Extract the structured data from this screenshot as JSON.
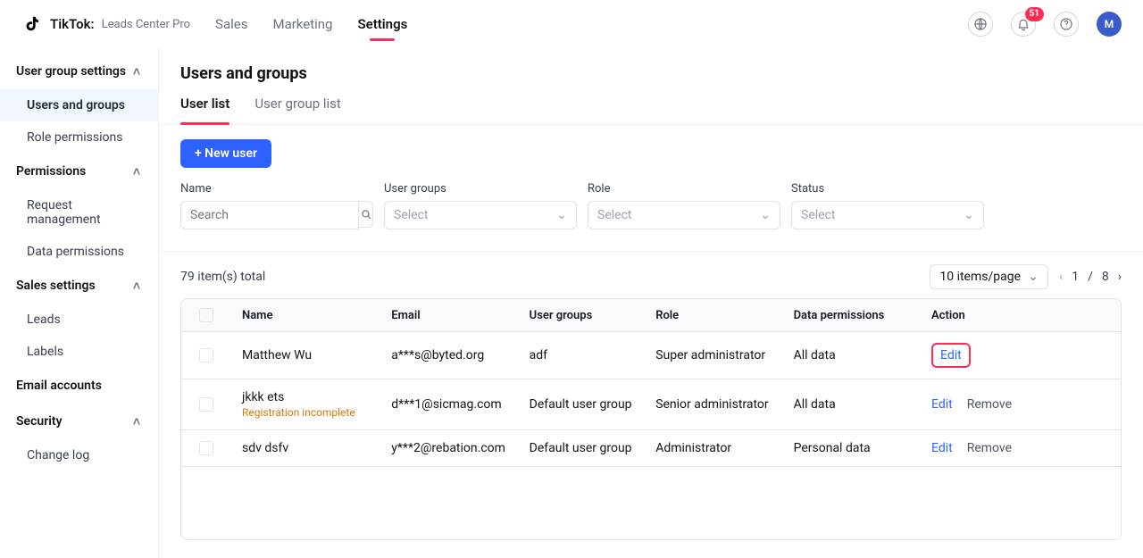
{
  "header": {
    "brand_main": "TikTok:",
    "brand_sub": "Leads Center Pro",
    "nav": [
      "Sales",
      "Marketing",
      "Settings"
    ],
    "nav_active_index": 2,
    "notification_count": "51",
    "avatar_letter": "M"
  },
  "sidebar": {
    "sections": [
      {
        "title": "User group settings",
        "expanded": true,
        "items": [
          "Users and groups",
          "Role permissions"
        ],
        "active_index": 0
      },
      {
        "title": "Permissions",
        "expanded": true,
        "items": [
          "Request management",
          "Data permissions"
        ]
      },
      {
        "title": "Sales settings",
        "expanded": true,
        "items": [
          "Leads",
          "Labels"
        ]
      },
      {
        "title": "Email accounts",
        "single": true
      },
      {
        "title": "Security",
        "expanded": true,
        "items": [
          "Change log"
        ]
      }
    ]
  },
  "page": {
    "title": "Users and groups",
    "subtabs": [
      "User list",
      "User group list"
    ],
    "subtab_active_index": 0,
    "new_user_label": "+ New user"
  },
  "filters": {
    "name": {
      "label": "Name",
      "placeholder": "Search"
    },
    "user_groups": {
      "label": "User groups",
      "placeholder": "Select"
    },
    "role": {
      "label": "Role",
      "placeholder": "Select"
    },
    "status": {
      "label": "Status",
      "placeholder": "Select"
    }
  },
  "table": {
    "total_text": "79 item(s) total",
    "page_size_label": "10 items/page",
    "current_page": "1",
    "sep": "/",
    "total_pages": "8",
    "columns": [
      "Name",
      "Email",
      "User groups",
      "Role",
      "Data permissions",
      "Action"
    ],
    "actions": {
      "edit": "Edit",
      "remove": "Remove"
    },
    "rows": [
      {
        "name": "Matthew Wu",
        "warn": "",
        "email": "a***s@byted.org",
        "groups": "adf",
        "role": "Super administrator",
        "perm": "All data",
        "removable": false,
        "highlight_edit": true
      },
      {
        "name": "jkkk ets",
        "warn": "Registration incomplete",
        "email": "d***1@sicmag.com",
        "groups": "Default user group",
        "role": "Senior administrator",
        "perm": "All data",
        "removable": true,
        "highlight_edit": false
      },
      {
        "name": "sdv dsfv",
        "warn": "",
        "email": "y***2@rebation.com",
        "groups": "Default user group",
        "role": "Administrator",
        "perm": "Personal data",
        "removable": true,
        "highlight_edit": false
      }
    ]
  }
}
